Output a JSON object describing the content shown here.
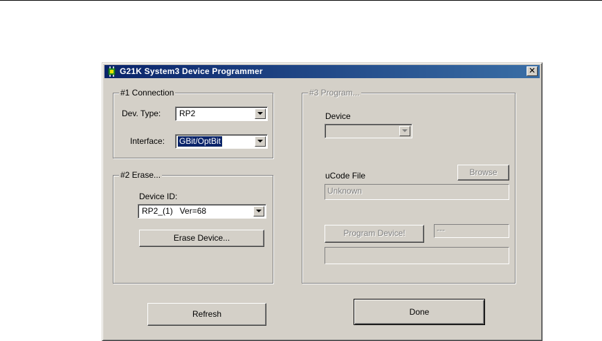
{
  "window": {
    "title": "G21K  System3 Device Programmer",
    "close_glyph": "✕",
    "icon": "green-chip-icon"
  },
  "connection": {
    "legend": "#1 Connection",
    "dev_type_label": "Dev. Type:",
    "dev_type_value": "RP2",
    "interface_label": "Interface:",
    "interface_value": "GBit/OptBit"
  },
  "erase": {
    "legend": "#2 Erase...",
    "device_id_label": "Device ID:",
    "device_id_value": "RP2_(1)   Ver=68",
    "erase_button": "Erase Device..."
  },
  "program": {
    "legend": "#3 Program...",
    "device_label": "Device",
    "device_value": "",
    "ucode_label": "uCode File",
    "browse_button": "Browse",
    "ucode_value": "Unknown",
    "program_button": "Program Device!",
    "status_value": "---",
    "progress_value": ""
  },
  "footer": {
    "refresh_button": "Refresh",
    "done_button": "Done"
  },
  "colors": {
    "face": "#d4d0c8",
    "title_start": "#0a246a",
    "title_end": "#3a6ea5",
    "disabled_text": "#808080"
  }
}
